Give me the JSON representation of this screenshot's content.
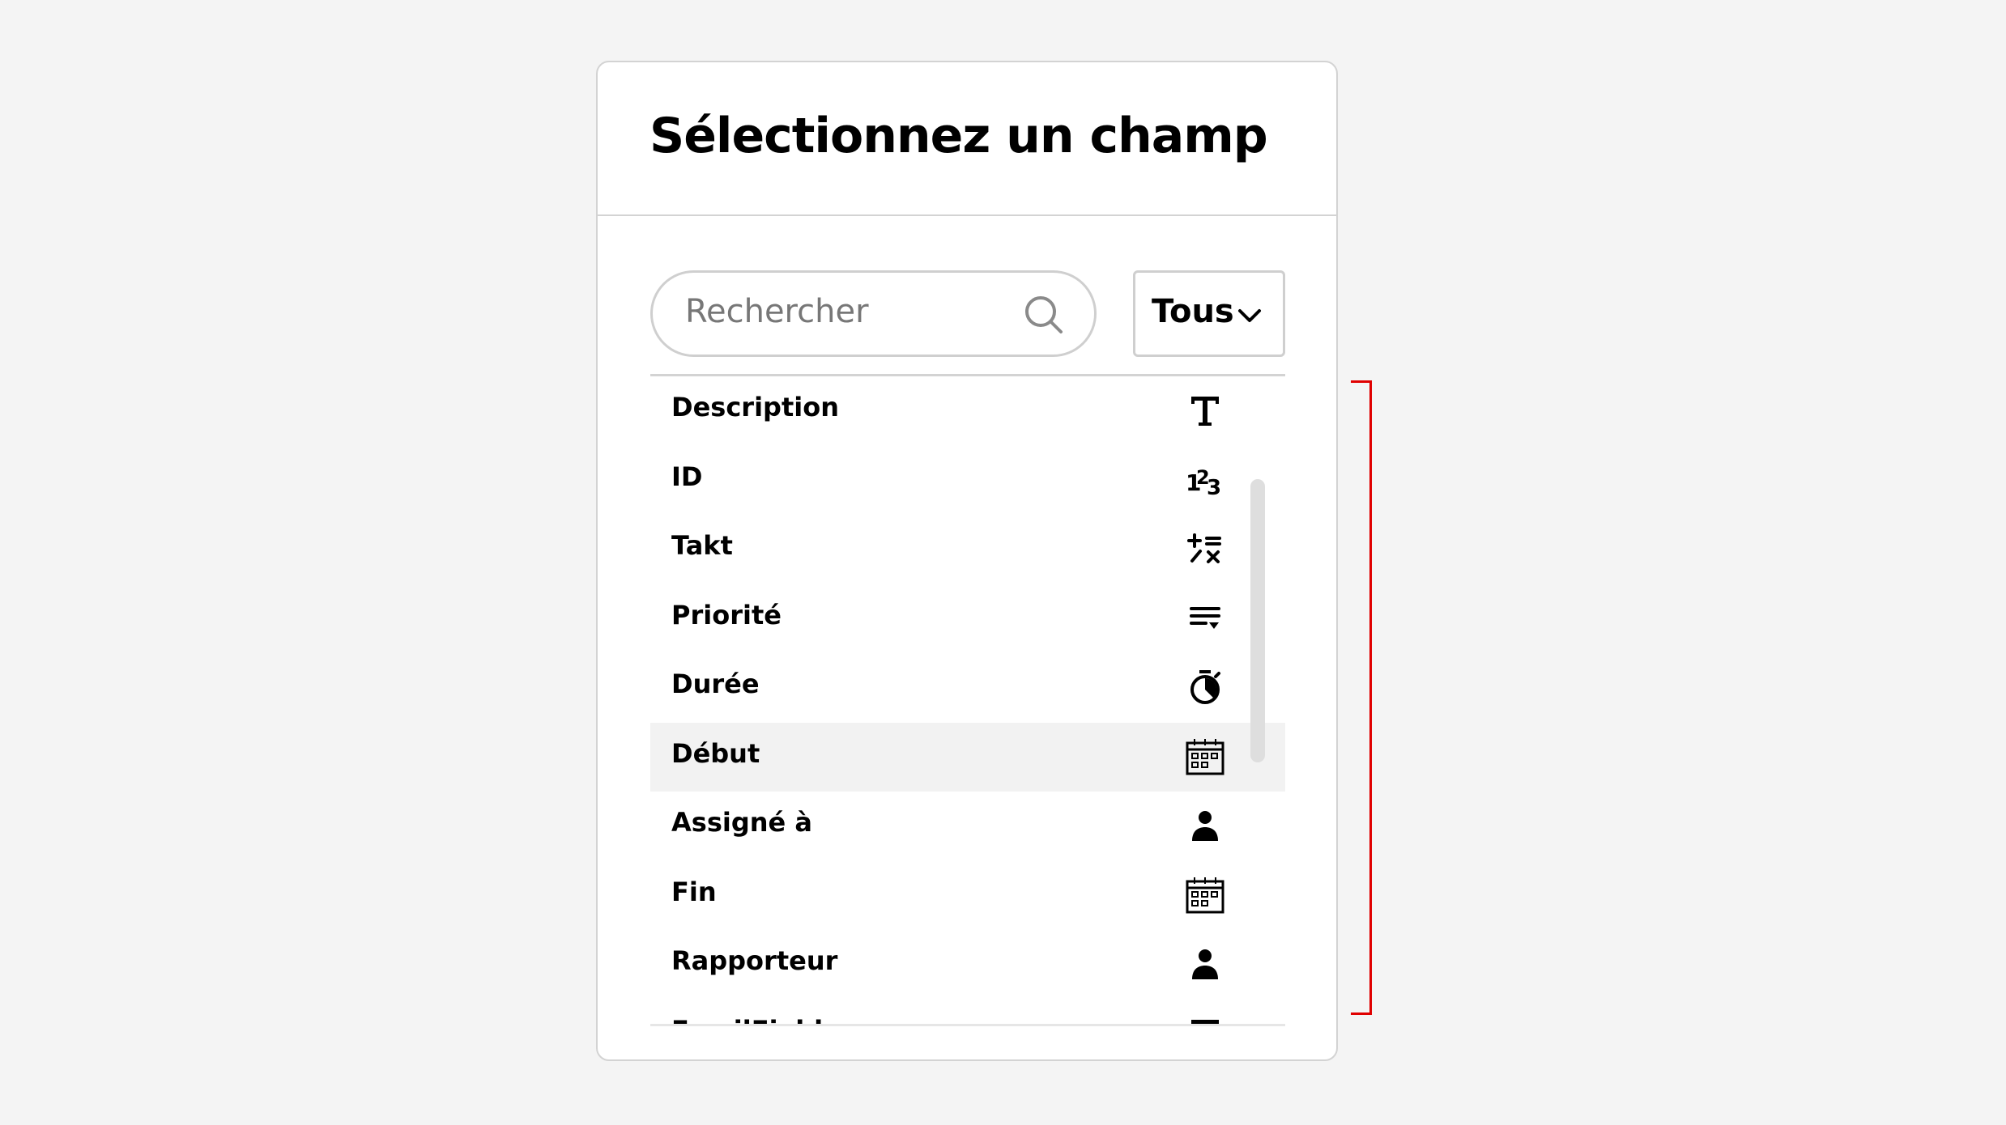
{
  "dialog": {
    "title": "Sélectionnez un champ",
    "search": {
      "placeholder": "Rechercher",
      "icon": "search-icon"
    },
    "filter": {
      "selected": "Tous",
      "icon": "chevron-down-icon"
    }
  },
  "fields": [
    {
      "label": "Description",
      "icon": "text-type-icon"
    },
    {
      "label": "ID",
      "icon": "number-type-icon"
    },
    {
      "label": "Takt",
      "icon": "calculation-type-icon"
    },
    {
      "label": "Priorité",
      "icon": "priority-list-icon"
    },
    {
      "label": "Durée",
      "icon": "stopwatch-icon"
    },
    {
      "label": "Début",
      "icon": "calendar-icon",
      "selected": true
    },
    {
      "label": "Assigné à",
      "icon": "user-icon"
    },
    {
      "label": "Fin",
      "icon": "calendar-icon"
    },
    {
      "label": "Rapporteur",
      "icon": "user-icon"
    },
    {
      "label": "EmailField",
      "icon": "text-type-icon"
    }
  ],
  "colors": {
    "background": "#f4f4f4",
    "selected_row": "#f2f2f2",
    "border": "#d3d3d3",
    "annotation_bracket": "#e00000"
  }
}
